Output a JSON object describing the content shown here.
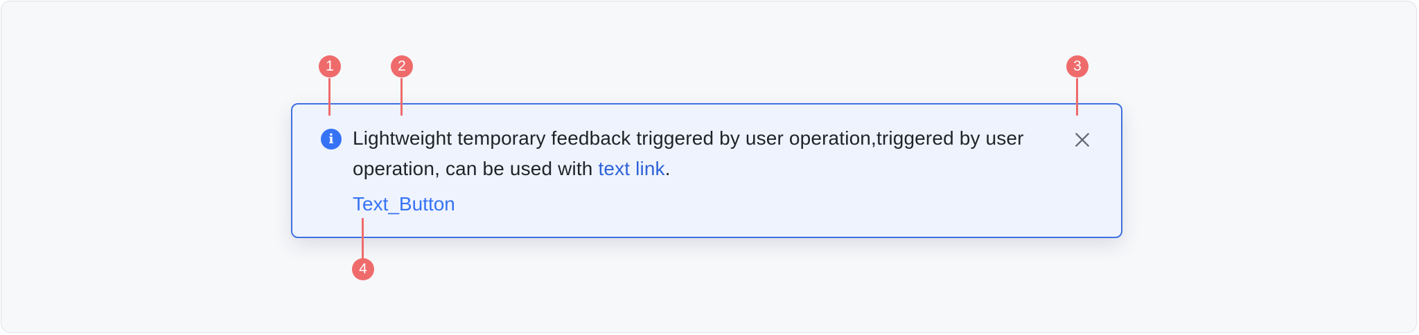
{
  "notification": {
    "message_text": "Lightweight temporary feedback triggered by user operation,triggered by user operation, can be used with ",
    "link_text": "text link",
    "message_suffix": ".",
    "button_label": "Text_Button",
    "info_icon_glyph": "i",
    "accent_color": "#3672f4",
    "border_color": "#3f6fe0",
    "background_color": "#eef3fd"
  },
  "callouts": [
    {
      "label": "1",
      "points_to": "info-icon"
    },
    {
      "label": "2",
      "points_to": "message-text"
    },
    {
      "label": "3",
      "points_to": "close-icon"
    },
    {
      "label": "4",
      "points_to": "text-button"
    }
  ]
}
